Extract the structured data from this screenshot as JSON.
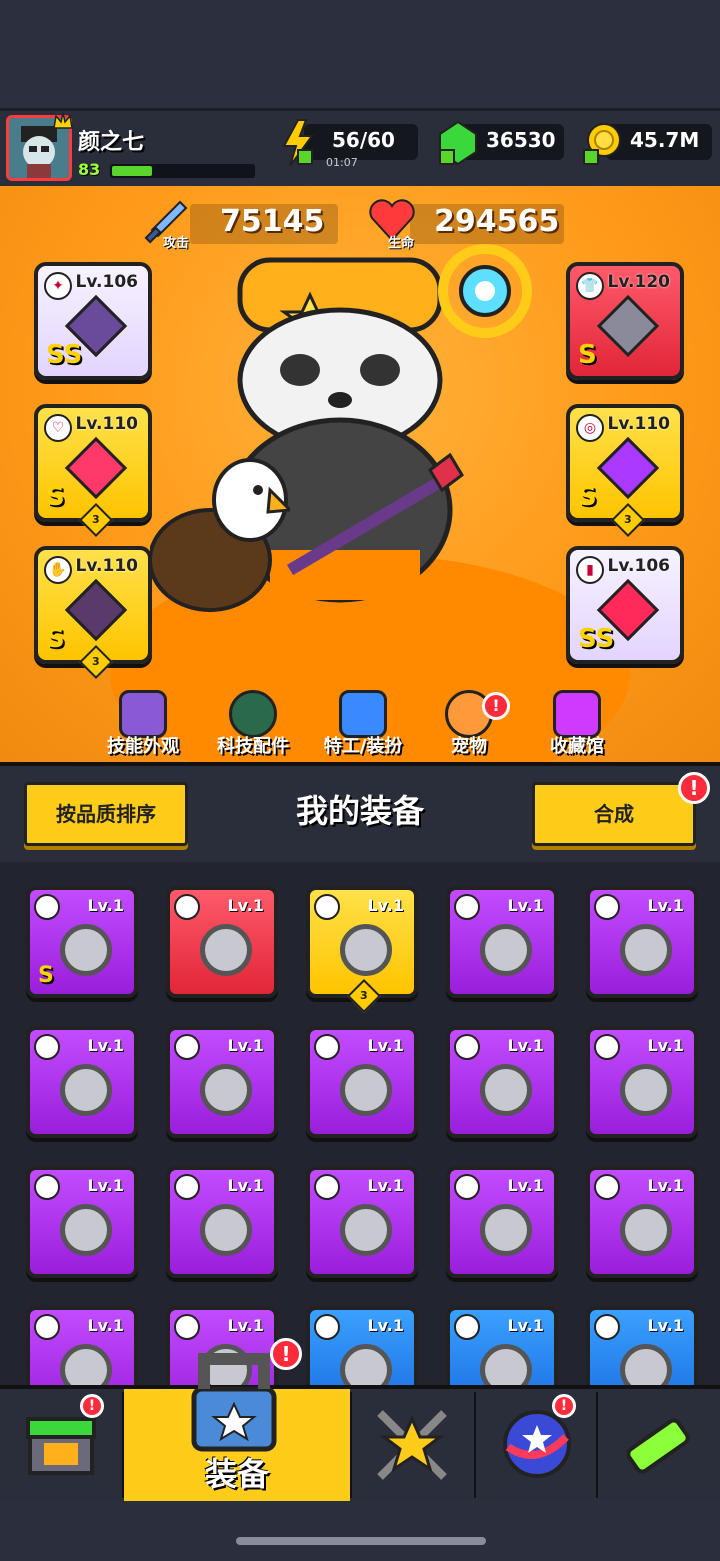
{
  "player": {
    "name": "颜之七",
    "level": "83",
    "energy": "56/60",
    "energy_timer": "01:07",
    "gems": "36530",
    "gold": "45.7M"
  },
  "stats": {
    "attack_value": "75145",
    "attack_label": "攻击",
    "hp_value": "294565",
    "hp_label": "生命"
  },
  "equipped": {
    "left": [
      {
        "level": "Lv.106",
        "rank": "SS",
        "color": "purple"
      },
      {
        "level": "Lv.110",
        "rank": "S",
        "stars": "3",
        "color": "yellow"
      },
      {
        "level": "Lv.110",
        "rank": "S",
        "stars": "3",
        "color": "yellow"
      }
    ],
    "right": [
      {
        "level": "Lv.120",
        "rank": "S",
        "color": "red"
      },
      {
        "level": "Lv.110",
        "rank": "S",
        "stars": "3",
        "color": "yellow"
      },
      {
        "level": "Lv.106",
        "rank": "SS",
        "color": "purple"
      }
    ]
  },
  "menu": {
    "items": [
      {
        "label": "技能外观",
        "icon": "hat-icon"
      },
      {
        "label": "科技配件",
        "icon": "hex-chip-icon"
      },
      {
        "label": "特工/装扮",
        "icon": "agent-icon"
      },
      {
        "label": "宠物",
        "icon": "dog-icon"
      },
      {
        "label": "收藏馆",
        "icon": "chest-icon"
      }
    ]
  },
  "equipment": {
    "sort_label": "按品质排序",
    "title": "我的装备",
    "merge_label": "合成",
    "badge": "!",
    "items": [
      {
        "level": "Lv.1",
        "color": "purple",
        "rank": "S"
      },
      {
        "level": "Lv.1",
        "color": "red"
      },
      {
        "level": "Lv.1",
        "color": "yellow",
        "stars": "3"
      },
      {
        "level": "Lv.1",
        "color": "purple"
      },
      {
        "level": "Lv.1",
        "color": "purple"
      },
      {
        "level": "Lv.1",
        "color": "purple"
      },
      {
        "level": "Lv.1",
        "color": "purple"
      },
      {
        "level": "Lv.1",
        "color": "purple"
      },
      {
        "level": "Lv.1",
        "color": "purple"
      },
      {
        "level": "Lv.1",
        "color": "purple"
      },
      {
        "level": "Lv.1",
        "color": "purple"
      },
      {
        "level": "Lv.1",
        "color": "purple"
      },
      {
        "level": "Lv.1",
        "color": "purple"
      },
      {
        "level": "Lv.1",
        "color": "purple"
      },
      {
        "level": "Lv.1",
        "color": "purple"
      },
      {
        "level": "Lv.1",
        "color": "purple"
      },
      {
        "level": "Lv.1",
        "color": "purple"
      },
      {
        "level": "Lv.1",
        "color": "blue"
      },
      {
        "level": "Lv.1",
        "color": "blue"
      },
      {
        "level": "Lv.1",
        "color": "blue"
      }
    ]
  },
  "nav": {
    "active_label": "装备"
  }
}
